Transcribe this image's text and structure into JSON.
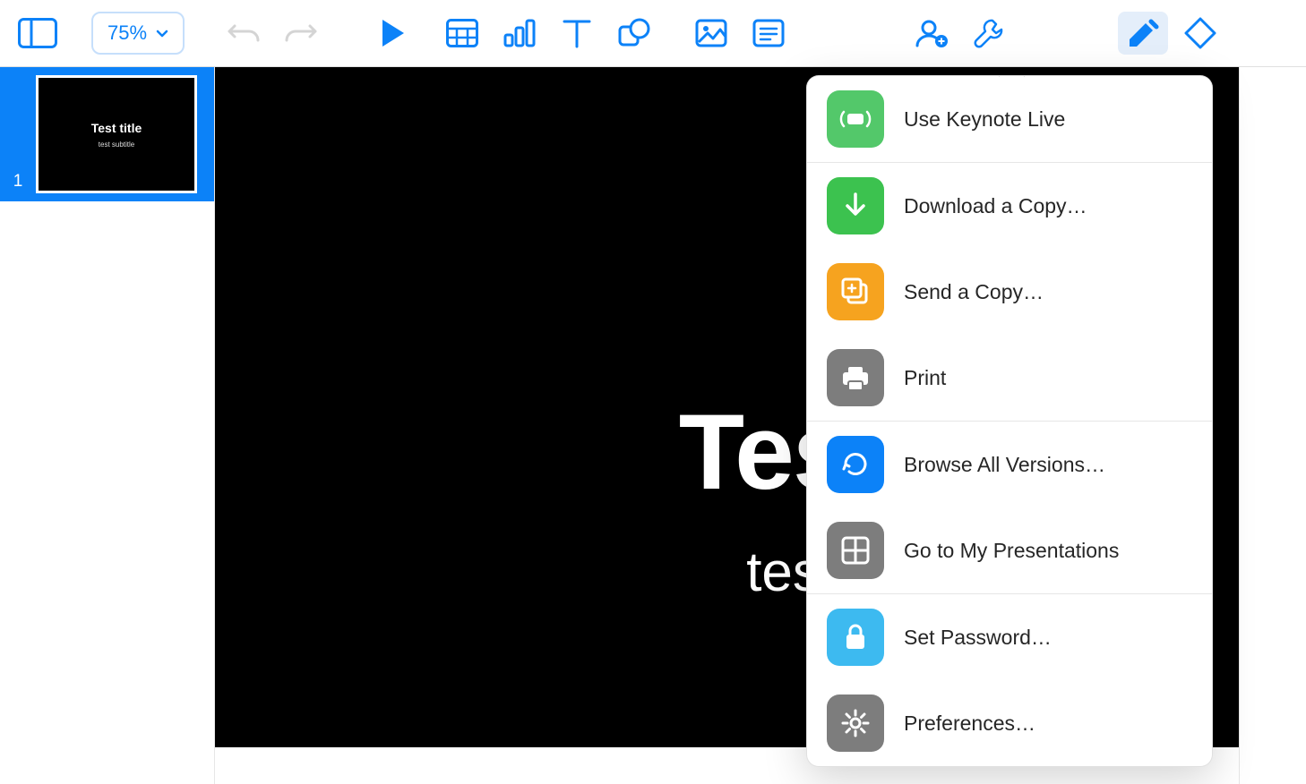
{
  "toolbar": {
    "zoom": "75%"
  },
  "slide": {
    "number": "1",
    "title": "Test title",
    "subtitle": "test subtitle"
  },
  "thumb": {
    "title": "Test title",
    "subtitle": "test subtitle"
  },
  "menu": {
    "keynote_live": "Use Keynote Live",
    "download": "Download a Copy…",
    "send_copy": "Send a Copy…",
    "print": "Print",
    "browse_versions": "Browse All Versions…",
    "go_presentations": "Go to My Presentations",
    "set_password": "Set Password…",
    "preferences": "Preferences…"
  }
}
